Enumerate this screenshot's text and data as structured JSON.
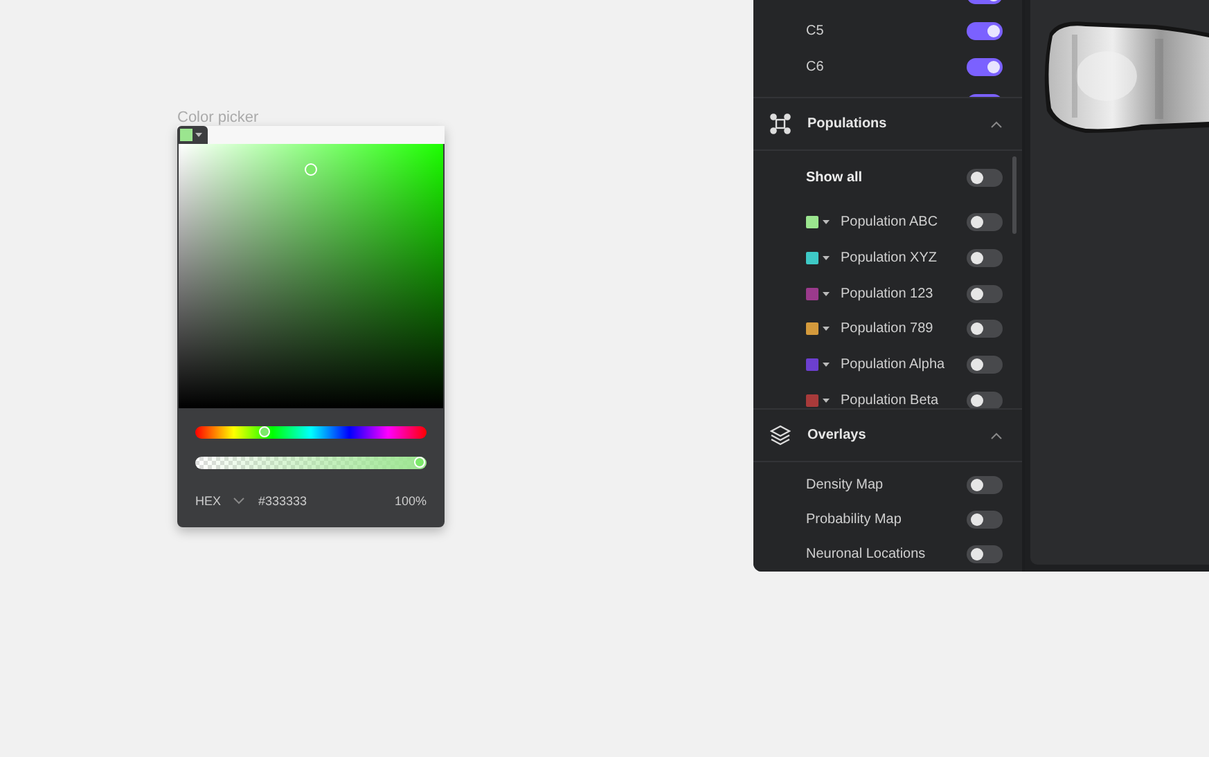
{
  "color_picker": {
    "title": "Color picker",
    "color": "#9be58f",
    "hue": {
      "level": 0.29
    },
    "alpha": {
      "level": 1
    },
    "format": "HEX",
    "hex": "#333333",
    "opacity": "100%"
  },
  "sidebar": {
    "channels": [
      {
        "on": true
      },
      {
        "label": "C5",
        "on": true
      },
      {
        "label": "C6",
        "on": true
      },
      {
        "on": true
      }
    ],
    "populations": {
      "title": "Populations",
      "expanded": true,
      "show_all": {
        "label": "Show all",
        "on": false
      },
      "items": [
        {
          "label": "Population ABC",
          "color": "#9be58f",
          "on": false
        },
        {
          "label": "Population XYZ",
          "color": "#3ec9c6",
          "on": false
        },
        {
          "label": "Population 123",
          "color": "#9b3a8c",
          "on": false
        },
        {
          "label": "Population 789",
          "color": "#d49a3c",
          "on": false
        },
        {
          "label": "Population Alpha",
          "color": "#6c3fd0",
          "on": false
        },
        {
          "label": "Population Beta",
          "color": "#a83a3a",
          "on": false
        }
      ]
    },
    "overlays": {
      "title": "Overlays",
      "expanded": true,
      "items": [
        {
          "label": "Density Map",
          "on": false
        },
        {
          "label": "Probability Map",
          "on": false
        },
        {
          "label": "Neuronal Locations",
          "on": false
        }
      ]
    }
  }
}
